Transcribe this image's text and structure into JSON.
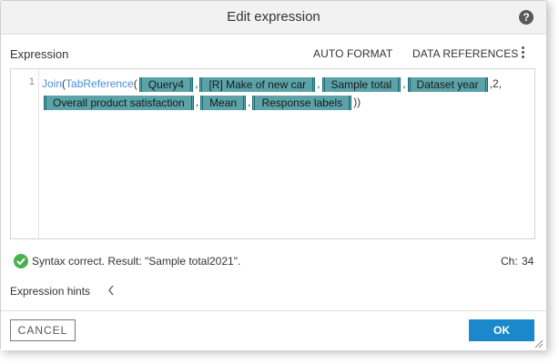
{
  "dialog": {
    "title": "Edit expression"
  },
  "toolbar": {
    "expression_label": "Expression",
    "auto_format": "AUTO FORMAT",
    "data_references": "DATA REFERENCES"
  },
  "editor": {
    "line_number": "1",
    "function_join": "Join",
    "function_tabref": "TabReference",
    "open_paren_1": "(",
    "open_paren_2": "(",
    "comma": ",",
    "literal_2": "2",
    "closing": "))",
    "tokens": {
      "query": "Query4",
      "make": "[R] Make of new car",
      "sample_total": "Sample total",
      "dataset_year": "Dataset year",
      "satisfaction": "Overall product satisfaction",
      "mean": "Mean",
      "response_labels": "Response labels"
    }
  },
  "status": {
    "message": "Syntax correct. Result: \"Sample total2021\".",
    "ch_label": "Ch:",
    "ch_value": "34"
  },
  "hints": {
    "label": "Expression hints"
  },
  "footer": {
    "cancel": "CANCEL",
    "ok": "OK"
  },
  "colors": {
    "accent": "#1c88cc",
    "token_bg": "#5ba3a8",
    "function": "#4a8fd8",
    "success": "#4caf50"
  }
}
